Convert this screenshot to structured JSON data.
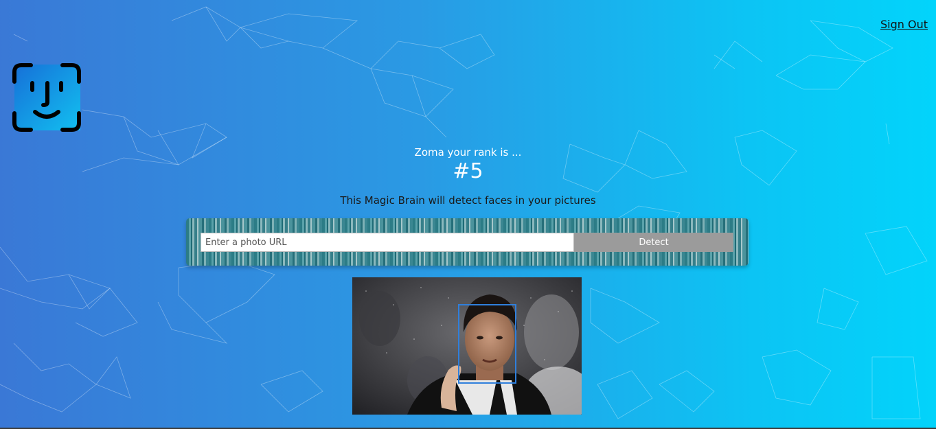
{
  "header": {
    "signout_label": "Sign Out"
  },
  "logo": {
    "icon": "face-id-icon",
    "gradient_start": "#1670d8",
    "gradient_end": "#12c0f0"
  },
  "rank": {
    "caption": "Zoma your rank is ...",
    "number": "#5"
  },
  "tagline": "This Magic Brain will detect faces in your pictures",
  "form": {
    "url_placeholder": "Enter a photo URL",
    "url_value": "",
    "detect_label": "Detect"
  },
  "result_image": {
    "description_icon": "detected-photo",
    "face_box_color": "#2f7fdc"
  },
  "colors": {
    "bg_start": "#3a78d6",
    "bg_end": "#02d4fb",
    "button_gray": "#9b9b9b"
  }
}
